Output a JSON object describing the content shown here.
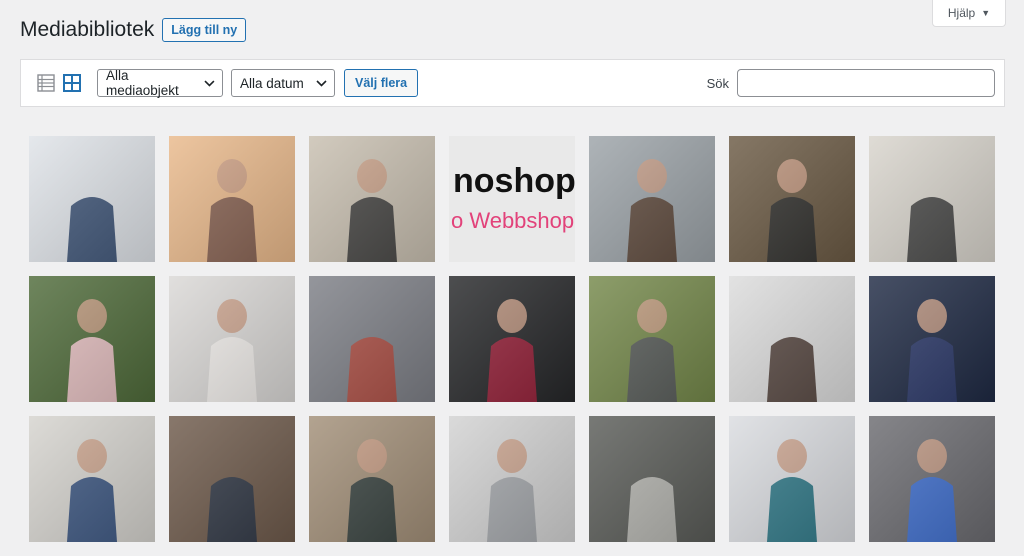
{
  "header": {
    "title": "Mediabibliotek",
    "add_new_label": "Lägg till ny"
  },
  "help_tab": {
    "label": "Hjälp"
  },
  "toolbar": {
    "type_filter": {
      "selected": "Alla mediaobjekt"
    },
    "date_filter": {
      "selected": "Alla datum"
    },
    "select_multiple_label": "Välj flera",
    "search_label": "Sök",
    "search_value": ""
  },
  "media": [
    {
      "name": "sunglasses-striped-shirt",
      "bg": "#dfe3e8",
      "fg": "#31486e"
    },
    {
      "name": "woman-blonde-hair",
      "bg": "#e9b98b",
      "fg": "#7d5a4c"
    },
    {
      "name": "clothing-rack-store",
      "bg": "#c8bfb0",
      "fg": "#3a3a3a"
    },
    {
      "name": "webbshop-logo",
      "bg": "#e9e9e9",
      "fg": "#e2427a",
      "logo_text": "noshop",
      "logo_sub": "o Webbshop"
    },
    {
      "name": "man-boots-bag",
      "bg": "#9ca3a8",
      "fg": "#5a4233"
    },
    {
      "name": "boots-forest",
      "bg": "#6b5a44",
      "fg": "#2d2d2d"
    },
    {
      "name": "girl-cat-sweater",
      "bg": "#d8d4cc",
      "fg": "#3d3d3d"
    },
    {
      "name": "pink-sneakers",
      "bg": "#4f6b3a",
      "fg": "#f2c7cd"
    },
    {
      "name": "woman-white-scarf",
      "bg": "#dad8d6",
      "fg": "#f2f0ec"
    },
    {
      "name": "red-scarf-coffee",
      "bg": "#7d7f86",
      "fg": "#b04a3e"
    },
    {
      "name": "suit-red-tie",
      "bg": "#262729",
      "fg": "#a0203a"
    },
    {
      "name": "gray-vest-bowtie",
      "bg": "#74884a",
      "fg": "#55585b"
    },
    {
      "name": "man-tshirt-print",
      "bg": "#dcdcdc",
      "fg": "#4a3a33"
    },
    {
      "name": "navy-suit-dotted-tie",
      "bg": "#1f2a44",
      "fg": "#2e3b6e"
    },
    {
      "name": "jeans-beach",
      "bg": "#d5d3ce",
      "fg": "#2e4a7a"
    },
    {
      "name": "woman-jeans-boots",
      "bg": "#6e5a4b",
      "fg": "#2b3546"
    },
    {
      "name": "patterned-sweater",
      "bg": "#a28f78",
      "fg": "#2f3c3b"
    },
    {
      "name": "man-gray-tshirt",
      "bg": "#d2d2d2",
      "fg": "#9ea2a6"
    },
    {
      "name": "gray-knit-scarf",
      "bg": "#5a5c58",
      "fg": "#bdbdb8"
    },
    {
      "name": "man-teal-tshirt",
      "bg": "#dadce0",
      "fg": "#1f6f80"
    },
    {
      "name": "blue-sneakers",
      "bg": "#6b6b70",
      "fg": "#3b6fd6"
    }
  ]
}
